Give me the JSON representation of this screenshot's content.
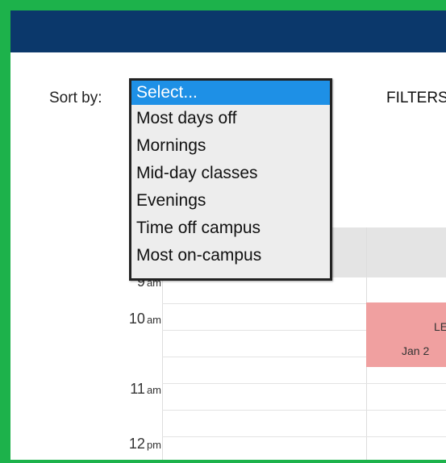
{
  "toolbar": {
    "sort_label": "Sort by:",
    "filters_label": "FILTERS"
  },
  "sort_dropdown": {
    "selected": "Select...",
    "options": [
      "Select...",
      "Most days off",
      "Mornings",
      "Mid-day classes",
      "Evenings",
      "Time off campus",
      "Most on-campus"
    ]
  },
  "calendar": {
    "times": [
      {
        "hour": "9",
        "ampm": "am"
      },
      {
        "hour": "10",
        "ampm": "am"
      },
      {
        "hour": "11",
        "ampm": "am"
      },
      {
        "hour": "12",
        "ampm": "pm"
      }
    ],
    "event": {
      "line1": "LE",
      "line2": "Jan 2"
    }
  },
  "colors": {
    "frame": "#1db24b",
    "banner": "#0b386b",
    "selected_option": "#1e90e6",
    "event": "#f0a0a0"
  }
}
